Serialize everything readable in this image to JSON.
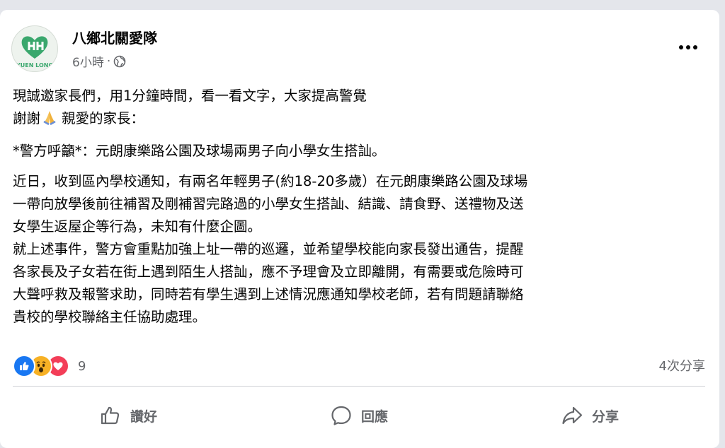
{
  "post": {
    "page_name": "八鄉北關愛隊",
    "time": "6小時",
    "separator": "·",
    "avatar_text": "YUEN LONG",
    "lines": {
      "l1": "現誠邀家長們，用1分鐘時間，看一看文字，大家提高警覺",
      "l2a": "謝謝",
      "l2b": "親愛的家長：",
      "l3": "*警方呼籲*：元朗康樂路公園及球場兩男子向小學女生搭訕。",
      "l4": "近日，收到區內學校通知，有兩名年輕男子(約18-20多歲）在元朗康樂路公園及球場",
      "l5": "一帶向放學後前往補習及剛補習完路過的小學女生搭訕、結識、請食野、送禮物及送",
      "l6": "女學生返屋企等行為，未知有什麼企圖。",
      "l7": "就上述事件，警方會重點加強上址一帶的巡邏，並希望學校能向家長發出通告，提醒",
      "l8": "各家長及子女若在街上遇到陌生人搭訕，應不予理會及立即離開，有需要或危險時可",
      "l9": "大聲呼救及報警求助，同時若有學生遇到上述情況應通知學校老師，若有問題請聯絡",
      "l10": "貴校的學校聯絡主任協助處理。"
    }
  },
  "stats": {
    "reaction_count": "9",
    "share_count": "4次分享"
  },
  "actions": {
    "like": "讚好",
    "comment": "回應",
    "share": "分享"
  },
  "icons": {
    "avatar": "heart-logo-icon",
    "audience": "globe-icon",
    "more": "more-options-icon",
    "pray": "folded-hands-icon",
    "like": "thumbs-up-icon",
    "wow": "wow-face-icon",
    "love": "heart-icon",
    "comment": "comment-bubble-icon",
    "share": "share-arrow-icon"
  },
  "colors": {
    "like_blue": "#1877f2",
    "wow_yellow": "#f7b125",
    "love_red": "#f33e58",
    "secondary_text": "#65676b"
  }
}
